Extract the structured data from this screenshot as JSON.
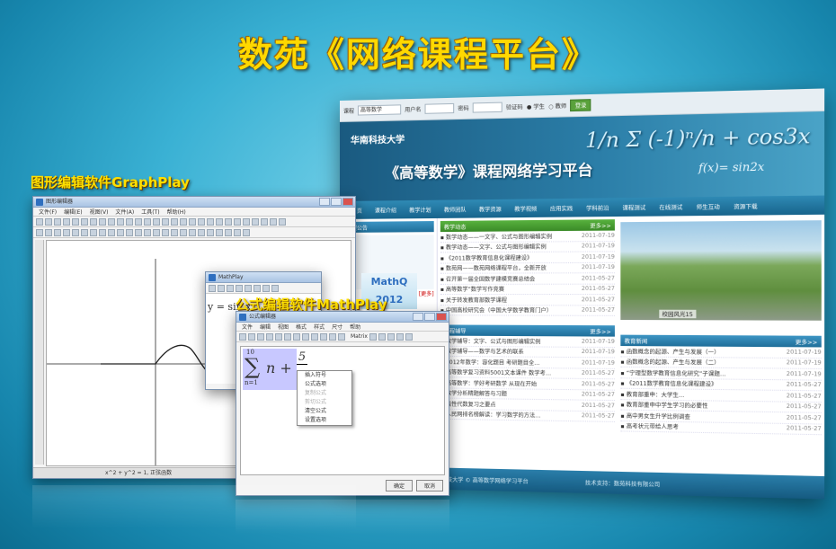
{
  "page": {
    "title": "数苑《网络课程平台》",
    "graph_label": "图形编辑软件GraphPlay",
    "math_label": "公式编辑软件MathPlay"
  },
  "site": {
    "login": {
      "course_label": "课程",
      "course_value": "高等数学",
      "user_label": "用户名",
      "pass_label": "密码",
      "code_label": "验证码",
      "role_student": "学生",
      "role_teacher": "教师",
      "submit": "登录"
    },
    "university": "华南科技大学",
    "platform_title": "《高等数学》课程网络学习平台",
    "formula": "1/n Σ (-1)ⁿ/n + cos3x",
    "formula2": "f(x)= sin2x",
    "nav": [
      "首 页",
      "课程介绍",
      "教学计划",
      "教师团队",
      "教学资源",
      "教学视频",
      "应用实践",
      "学科前沿",
      "课程测试",
      "在线测试",
      "师生互动",
      "资源下载"
    ],
    "left_head": "课程公告",
    "left_more": "[更多]",
    "news_head": "教学动态",
    "news_more": "更多>>",
    "news": [
      {
        "t": "数学动态——一文字、公式与图形编辑实例",
        "d": "2011-07-19"
      },
      {
        "t": "教学动态——文字、公式与图形编辑实例",
        "d": "2011-07-19"
      },
      {
        "t": "《2011数学教育信息化课程建设》",
        "d": "2011-07-19"
      },
      {
        "t": "数苑网——数苑网络课程平台，全新开放",
        "d": "2011-07-19"
      },
      {
        "t": "召开第一届全国数学建模竞赛总结会",
        "d": "2011-05-27"
      },
      {
        "t": "高等数学”数学写作竞赛",
        "d": "2011-05-27"
      },
      {
        "t": "关于转发教育部数学课程",
        "d": "2011-05-27"
      },
      {
        "t": "中国高校研究会（中国大学数学教育门户）",
        "d": "2011-05-27"
      }
    ],
    "photo_caption": "校园风光15",
    "tutor_head": "课程辅导",
    "tutor_more": "更多>>",
    "tutor": [
      {
        "t": "数学辅导：文字、公式与图形编辑实例",
        "d": "2011-07-19"
      },
      {
        "t": "教学辅导——数学与艺术的联系",
        "d": "2011-07-19"
      },
      {
        "t": "2012年数学：容化题目 考研题目全…",
        "d": "2011-07-19"
      },
      {
        "t": "高等数学复习资料5001文本课件 数学考…",
        "d": "2011-05-27"
      },
      {
        "t": "高等数学：学好考研数学 从现在开始",
        "d": "2011-05-27"
      },
      {
        "t": "数学分析精题解答与习题",
        "d": "2011-05-27"
      },
      {
        "t": "线性代数复习之要点",
        "d": "2011-05-27"
      },
      {
        "t": "人民网排名榜解读：学习数学的方法…",
        "d": "2011-05-27"
      }
    ],
    "edu_head": "教育新闻",
    "edu_more": "更多>>",
    "edu": [
      {
        "t": "函数概念的起源、产生与发展（一）",
        "d": "2011-07-19"
      },
      {
        "t": "函数概念的起源、产生与发展（二）",
        "d": "2011-07-19"
      },
      {
        "t": "“宁理型数学教育信息化研究”子课题…",
        "d": "2011-07-19"
      },
      {
        "t": "《2011数学教育信息化课程建设》",
        "d": "2011-05-27"
      },
      {
        "t": "教育部重申：大学生…",
        "d": "2011-05-27"
      },
      {
        "t": "教育部重申中学生学习的必要性",
        "d": "2011-05-27"
      },
      {
        "t": "高中男女生升学比例调查",
        "d": "2011-05-27"
      },
      {
        "t": "高考状元带给人思考",
        "d": "2011-05-27"
      }
    ],
    "footer_left": "版权所有：华南科技大学 © 高等数学网络学习平台",
    "footer_right": "技术支持：数苑科技有限公司"
  },
  "graph_win": {
    "title": "图形编辑器",
    "menus": [
      "文件(F)",
      "编辑(E)",
      "视图(V)",
      "文件(A)",
      "工具(T)",
      "帮助(H)"
    ],
    "status": "x^2 + y^2 = 1, 正弦函数"
  },
  "mid_win": {
    "title": "MathPlay",
    "formula": "y = sin x",
    "banner": "MathQ 2012"
  },
  "math_win": {
    "title": "公式编辑器",
    "menus": [
      "文件",
      "编辑",
      "视图",
      "格式",
      "样式",
      "尺寸",
      "帮助"
    ],
    "toolbar_text": "Matrix",
    "formula_upper": "10",
    "formula_var": "n",
    "formula_lower": "n=1",
    "formula_num": "5",
    "formula_den": "n",
    "ctx": [
      {
        "t": "插入符号",
        "dis": false
      },
      {
        "t": "公式选项",
        "dis": false
      },
      {
        "t": "复制公式",
        "dis": true
      },
      {
        "t": "剪切公式",
        "dis": true
      },
      {
        "t": "清空公式",
        "dis": false
      },
      {
        "t": "设置选项",
        "dis": false
      }
    ],
    "ok": "确定",
    "cancel": "取消"
  }
}
